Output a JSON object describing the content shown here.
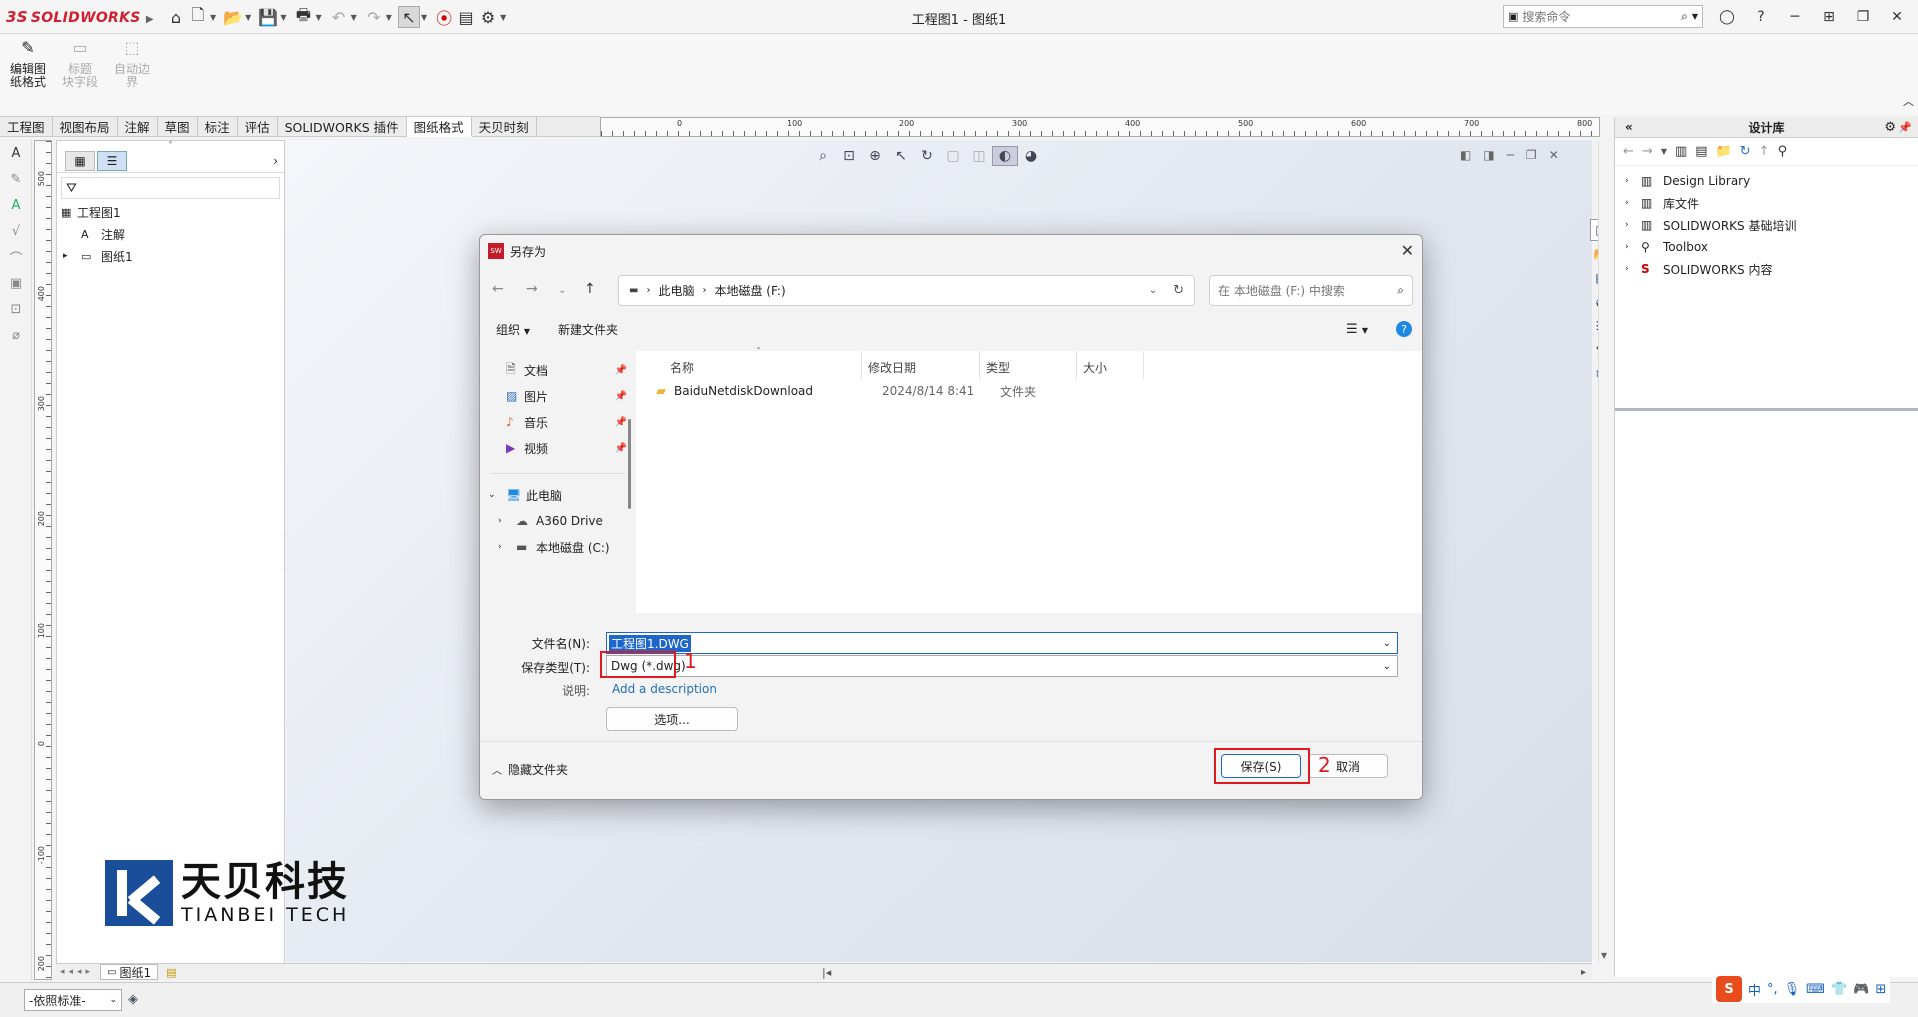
{
  "app": {
    "logo_ds": "3S",
    "logo_name": "SOLIDWORKS",
    "window_title": "工程图1 - 图纸1"
  },
  "search": {
    "placeholder": "搜索命令"
  },
  "ribbon": {
    "buttons": [
      {
        "label": "编辑图纸格式",
        "line1": "编辑图",
        "line2": "纸格式"
      },
      {
        "label": "标题块字段",
        "line1": "标题",
        "line2": "块字段"
      },
      {
        "label": "自动边界",
        "line1": "自动边",
        "line2": "界"
      }
    ]
  },
  "tabs": [
    "工程图",
    "视图布局",
    "注解",
    "草图",
    "标注",
    "评估",
    "SOLIDWORKS 插件",
    "图纸格式",
    "天贝时刻"
  ],
  "active_tab": "图纸格式",
  "hruler_ticks": [
    "0",
    "100",
    "200",
    "300",
    "400",
    "500",
    "600",
    "700",
    "800"
  ],
  "vruler_ticks": [
    "500",
    "400",
    "300",
    "200",
    "100",
    "0",
    "-100",
    "200"
  ],
  "tree": {
    "root": "工程图1",
    "children": [
      "注解",
      "图纸1"
    ]
  },
  "design_library": {
    "title": "设计库",
    "items": [
      "Design Library",
      "库文件",
      "SOLIDWORKS 基础培训",
      "Toolbox",
      "SOLIDWORKS 内容"
    ]
  },
  "sheet_tab": "图纸1",
  "status": {
    "standard": "-依照标准-"
  },
  "ime": {
    "lang": "中"
  },
  "watermark": {
    "cn": "天贝科技",
    "en": "TIANBEI TECH"
  },
  "dialog": {
    "title": "另存为",
    "breadcrumb": [
      "此电脑",
      "本地磁盘 (F:)"
    ],
    "search_placeholder": "在 本地磁盘 (F:) 中搜索",
    "toolbar": {
      "organize": "组织",
      "new_folder": "新建文件夹"
    },
    "nav_quick": [
      "文档",
      "图片",
      "音乐",
      "视频"
    ],
    "nav_pc": "此电脑",
    "nav_drives": [
      "A360 Drive",
      "本地磁盘 (C:)"
    ],
    "columns": [
      "名称",
      "修改日期",
      "类型",
      "大小"
    ],
    "files": [
      {
        "name": "BaiduNetdiskDownload",
        "date": "2024/8/14 8:41",
        "type": "文件夹",
        "size": ""
      }
    ],
    "filename_label": "文件名(N):",
    "filename_value": "工程图1.DWG",
    "filetype_label": "保存类型(T):",
    "filetype_value": "Dwg (*.dwg)",
    "desc_label": "说明:",
    "desc_link": "Add a description",
    "options_btn": "选项...",
    "hide_folders": "隐藏文件夹",
    "save_btn": "保存(S)",
    "cancel_btn": "取消",
    "annotation_1": "1",
    "annotation_2": "2",
    "accent": "#e0191e"
  }
}
